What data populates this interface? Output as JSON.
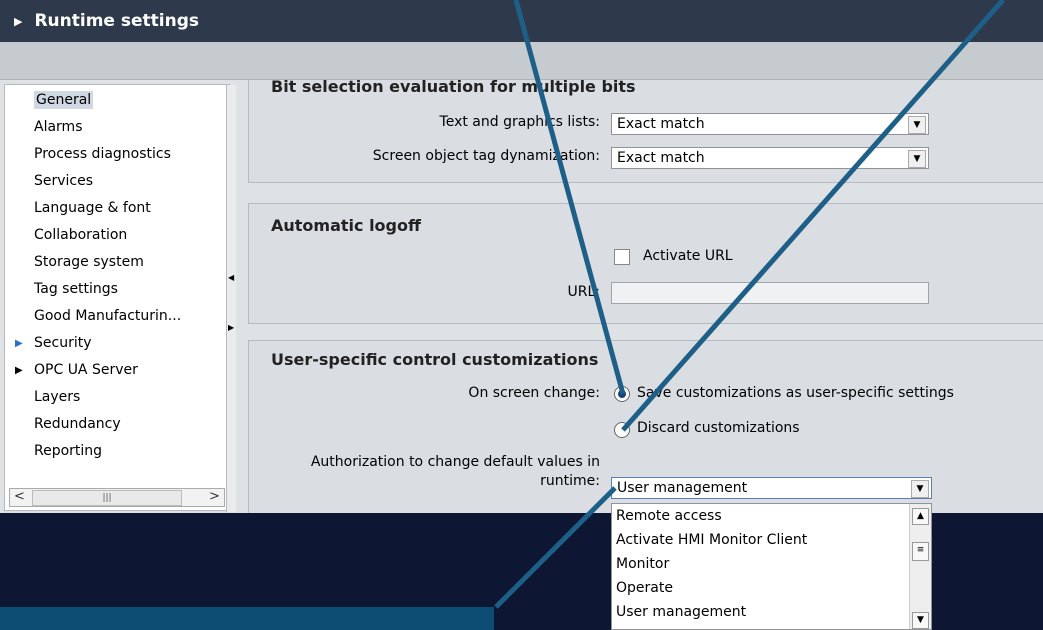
{
  "title": "Runtime settings",
  "nav": {
    "items": [
      {
        "label": "General",
        "arrow": ""
      },
      {
        "label": "Alarms",
        "arrow": ""
      },
      {
        "label": "Process diagnostics",
        "arrow": ""
      },
      {
        "label": "Services",
        "arrow": ""
      },
      {
        "label": "Language & font",
        "arrow": ""
      },
      {
        "label": "Collaboration",
        "arrow": ""
      },
      {
        "label": "Storage system",
        "arrow": ""
      },
      {
        "label": "Tag settings",
        "arrow": ""
      },
      {
        "label": "Good Manufacturin...",
        "arrow": ""
      },
      {
        "label": "Security",
        "arrow": "▶"
      },
      {
        "label": "OPC UA Server",
        "arrow": "▶"
      },
      {
        "label": "Layers",
        "arrow": ""
      },
      {
        "label": "Redundancy",
        "arrow": ""
      },
      {
        "label": "Reporting",
        "arrow": ""
      }
    ],
    "selected": "General"
  },
  "bit_selection": {
    "heading": "Bit selection evaluation for multiple bits",
    "text_lists_label": "Text and graphics lists:",
    "text_lists_value": "Exact match",
    "dyn_label": "Screen object tag dynamization:",
    "dyn_value": "Exact match"
  },
  "logoff": {
    "heading": "Automatic logoff",
    "activate_url_label": "Activate URL",
    "activate_url_checked": false,
    "url_label": "URL:",
    "url_value": ""
  },
  "custom": {
    "heading": "User-specific control customizations",
    "screen_change_label": "On screen change:",
    "save_option": "Save customizations as user-specific settings",
    "discard_option": "Discard customizations",
    "selected_option": "Save customizations as user-specific settings",
    "auth_label_line1": "Authorization to change default values in",
    "auth_label_line2": "runtime:",
    "auth_value": "User management"
  },
  "dropdown": {
    "options": [
      "Remote access",
      "Activate HMI Monitor Client",
      "Monitor",
      "Operate",
      "User management"
    ]
  },
  "colors": {
    "title_bar": "#2e3a4c",
    "background": "#0d1734",
    "callout_line": "#1d5f87",
    "radio_selected": "#1a3f7a"
  }
}
